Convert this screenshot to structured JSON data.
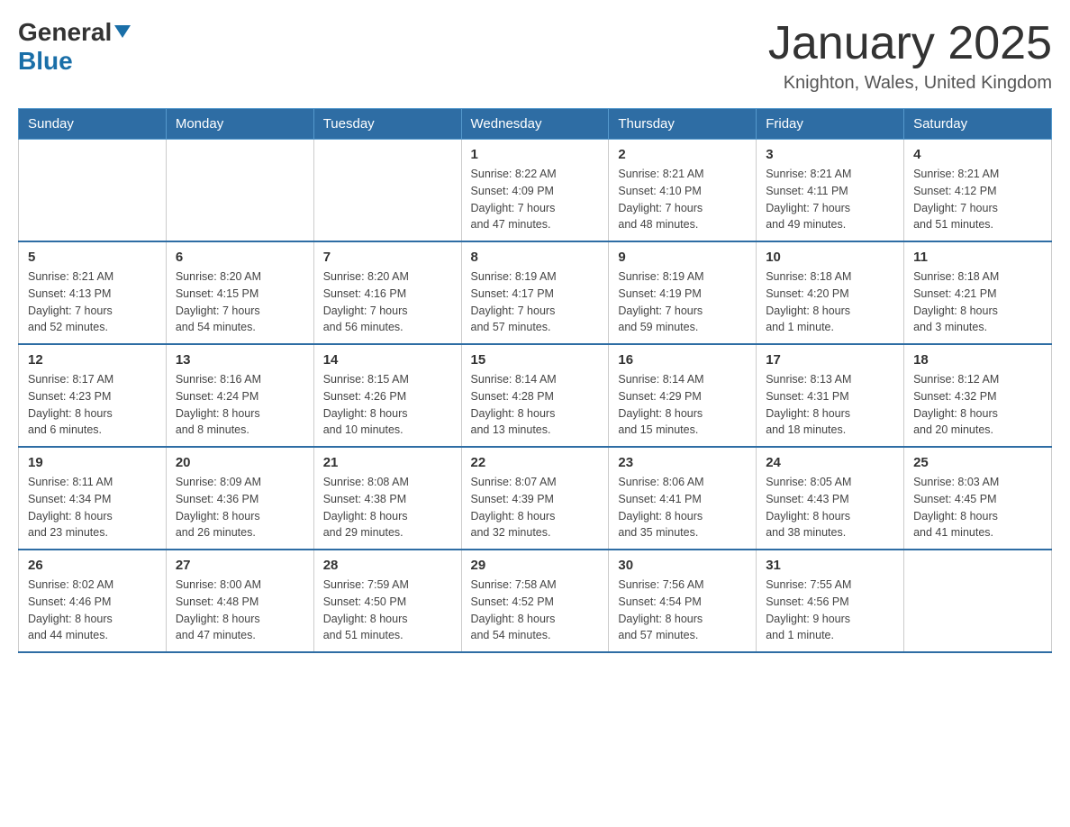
{
  "header": {
    "logo": {
      "general": "General",
      "blue": "Blue"
    },
    "title": "January 2025",
    "location": "Knighton, Wales, United Kingdom"
  },
  "weekdays": [
    "Sunday",
    "Monday",
    "Tuesday",
    "Wednesday",
    "Thursday",
    "Friday",
    "Saturday"
  ],
  "weeks": [
    [
      {
        "day": "",
        "info": ""
      },
      {
        "day": "",
        "info": ""
      },
      {
        "day": "",
        "info": ""
      },
      {
        "day": "1",
        "info": "Sunrise: 8:22 AM\nSunset: 4:09 PM\nDaylight: 7 hours\nand 47 minutes."
      },
      {
        "day": "2",
        "info": "Sunrise: 8:21 AM\nSunset: 4:10 PM\nDaylight: 7 hours\nand 48 minutes."
      },
      {
        "day": "3",
        "info": "Sunrise: 8:21 AM\nSunset: 4:11 PM\nDaylight: 7 hours\nand 49 minutes."
      },
      {
        "day": "4",
        "info": "Sunrise: 8:21 AM\nSunset: 4:12 PM\nDaylight: 7 hours\nand 51 minutes."
      }
    ],
    [
      {
        "day": "5",
        "info": "Sunrise: 8:21 AM\nSunset: 4:13 PM\nDaylight: 7 hours\nand 52 minutes."
      },
      {
        "day": "6",
        "info": "Sunrise: 8:20 AM\nSunset: 4:15 PM\nDaylight: 7 hours\nand 54 minutes."
      },
      {
        "day": "7",
        "info": "Sunrise: 8:20 AM\nSunset: 4:16 PM\nDaylight: 7 hours\nand 56 minutes."
      },
      {
        "day": "8",
        "info": "Sunrise: 8:19 AM\nSunset: 4:17 PM\nDaylight: 7 hours\nand 57 minutes."
      },
      {
        "day": "9",
        "info": "Sunrise: 8:19 AM\nSunset: 4:19 PM\nDaylight: 7 hours\nand 59 minutes."
      },
      {
        "day": "10",
        "info": "Sunrise: 8:18 AM\nSunset: 4:20 PM\nDaylight: 8 hours\nand 1 minute."
      },
      {
        "day": "11",
        "info": "Sunrise: 8:18 AM\nSunset: 4:21 PM\nDaylight: 8 hours\nand 3 minutes."
      }
    ],
    [
      {
        "day": "12",
        "info": "Sunrise: 8:17 AM\nSunset: 4:23 PM\nDaylight: 8 hours\nand 6 minutes."
      },
      {
        "day": "13",
        "info": "Sunrise: 8:16 AM\nSunset: 4:24 PM\nDaylight: 8 hours\nand 8 minutes."
      },
      {
        "day": "14",
        "info": "Sunrise: 8:15 AM\nSunset: 4:26 PM\nDaylight: 8 hours\nand 10 minutes."
      },
      {
        "day": "15",
        "info": "Sunrise: 8:14 AM\nSunset: 4:28 PM\nDaylight: 8 hours\nand 13 minutes."
      },
      {
        "day": "16",
        "info": "Sunrise: 8:14 AM\nSunset: 4:29 PM\nDaylight: 8 hours\nand 15 minutes."
      },
      {
        "day": "17",
        "info": "Sunrise: 8:13 AM\nSunset: 4:31 PM\nDaylight: 8 hours\nand 18 minutes."
      },
      {
        "day": "18",
        "info": "Sunrise: 8:12 AM\nSunset: 4:32 PM\nDaylight: 8 hours\nand 20 minutes."
      }
    ],
    [
      {
        "day": "19",
        "info": "Sunrise: 8:11 AM\nSunset: 4:34 PM\nDaylight: 8 hours\nand 23 minutes."
      },
      {
        "day": "20",
        "info": "Sunrise: 8:09 AM\nSunset: 4:36 PM\nDaylight: 8 hours\nand 26 minutes."
      },
      {
        "day": "21",
        "info": "Sunrise: 8:08 AM\nSunset: 4:38 PM\nDaylight: 8 hours\nand 29 minutes."
      },
      {
        "day": "22",
        "info": "Sunrise: 8:07 AM\nSunset: 4:39 PM\nDaylight: 8 hours\nand 32 minutes."
      },
      {
        "day": "23",
        "info": "Sunrise: 8:06 AM\nSunset: 4:41 PM\nDaylight: 8 hours\nand 35 minutes."
      },
      {
        "day": "24",
        "info": "Sunrise: 8:05 AM\nSunset: 4:43 PM\nDaylight: 8 hours\nand 38 minutes."
      },
      {
        "day": "25",
        "info": "Sunrise: 8:03 AM\nSunset: 4:45 PM\nDaylight: 8 hours\nand 41 minutes."
      }
    ],
    [
      {
        "day": "26",
        "info": "Sunrise: 8:02 AM\nSunset: 4:46 PM\nDaylight: 8 hours\nand 44 minutes."
      },
      {
        "day": "27",
        "info": "Sunrise: 8:00 AM\nSunset: 4:48 PM\nDaylight: 8 hours\nand 47 minutes."
      },
      {
        "day": "28",
        "info": "Sunrise: 7:59 AM\nSunset: 4:50 PM\nDaylight: 8 hours\nand 51 minutes."
      },
      {
        "day": "29",
        "info": "Sunrise: 7:58 AM\nSunset: 4:52 PM\nDaylight: 8 hours\nand 54 minutes."
      },
      {
        "day": "30",
        "info": "Sunrise: 7:56 AM\nSunset: 4:54 PM\nDaylight: 8 hours\nand 57 minutes."
      },
      {
        "day": "31",
        "info": "Sunrise: 7:55 AM\nSunset: 4:56 PM\nDaylight: 9 hours\nand 1 minute."
      },
      {
        "day": "",
        "info": ""
      }
    ]
  ]
}
